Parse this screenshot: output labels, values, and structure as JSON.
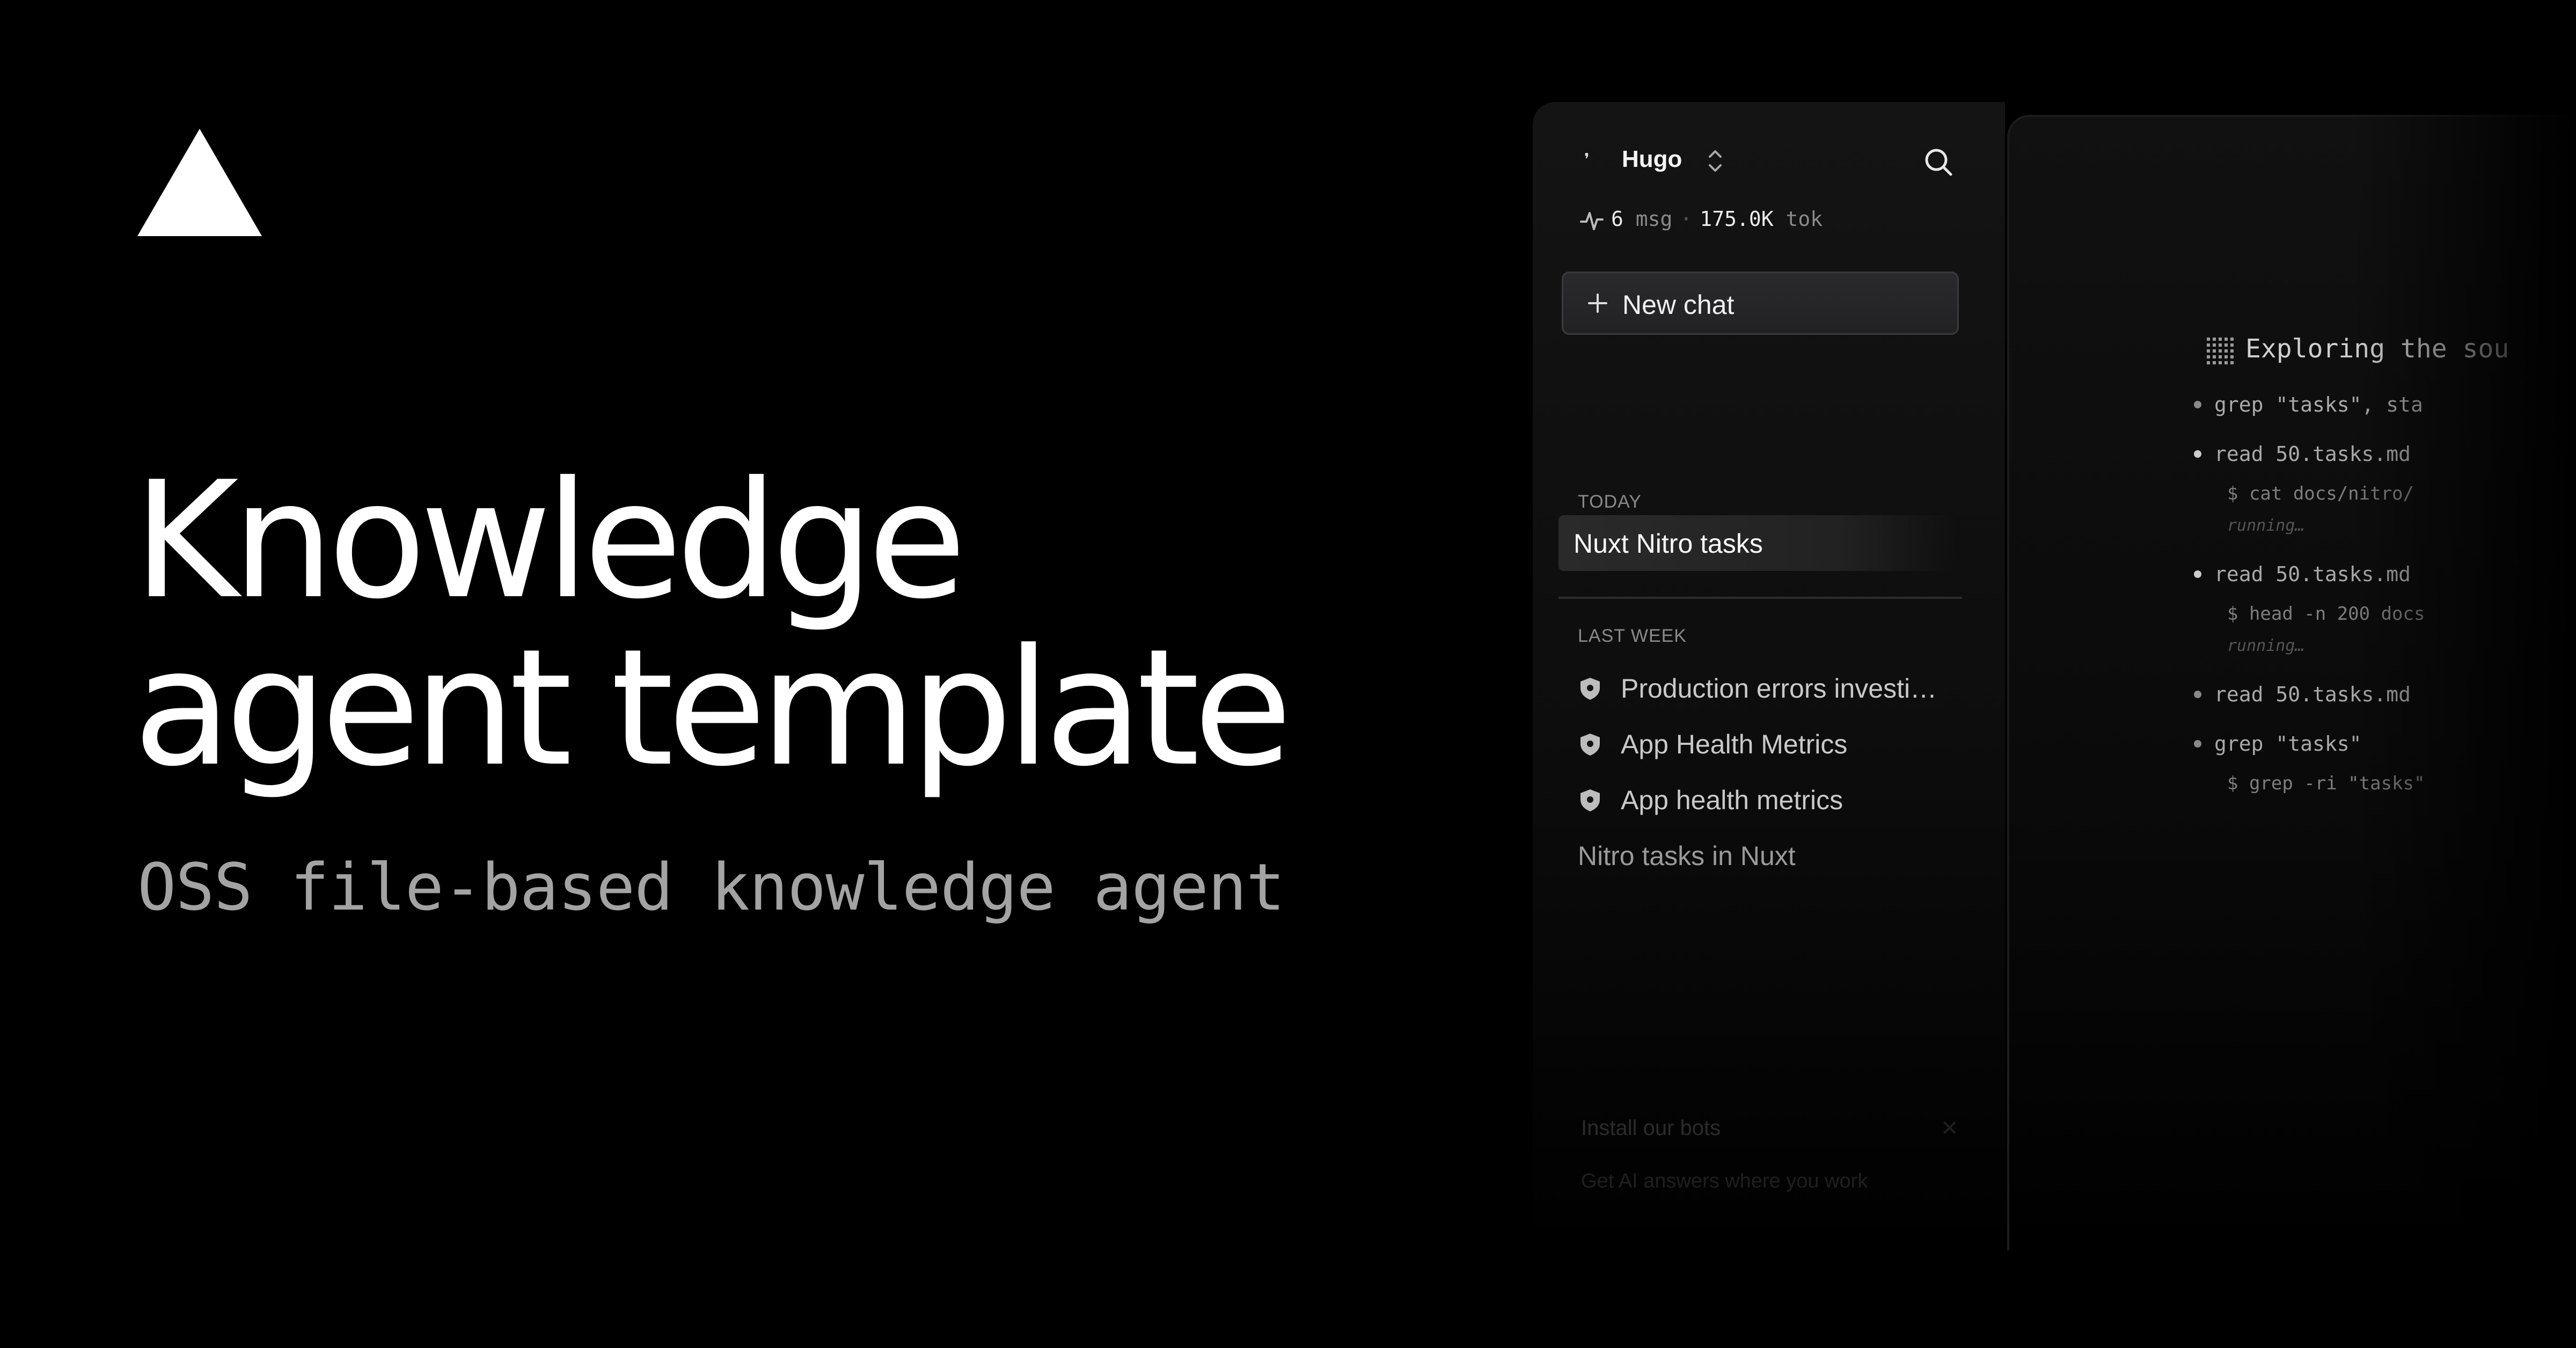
{
  "hero": {
    "title_line1": "Knowledge",
    "title_line2": "agent template",
    "subtitle": "OSS file-based knowledge agent"
  },
  "sidebar": {
    "user": "Hugo",
    "stats": {
      "msg_count": "6",
      "msg_unit": "msg",
      "separator": "·",
      "tokens": "175.0K",
      "tok_unit": "tok"
    },
    "new_chat_label": "New chat",
    "sections": [
      {
        "label": "TODAY",
        "items": [
          {
            "label": "Nuxt Nitro tasks",
            "active": true
          }
        ]
      },
      {
        "label": "LAST WEEK",
        "items": [
          {
            "label": "Production errors investi…",
            "icon": "shield-icon"
          },
          {
            "label": "App Health Metrics",
            "icon": "shield-icon"
          },
          {
            "label": "App health metrics",
            "icon": "shield-icon"
          },
          {
            "label": "Nitro tasks in Nuxt",
            "icon": ""
          }
        ]
      }
    ],
    "install": {
      "title": "Install our bots",
      "close": "✕",
      "subtitle": "Get AI answers where you work"
    }
  },
  "main": {
    "title": "Exploring the sou",
    "steps": [
      {
        "text": "grep \"tasks\", sta"
      },
      {
        "text": "read 50.tasks.md",
        "cmd": "$ cat docs/nitro/",
        "status": "running…"
      },
      {
        "text": "read 50.tasks.md",
        "cmd": "$ head -n 200 docs",
        "status": "running…"
      },
      {
        "text": "read 50.tasks.md"
      },
      {
        "text": "grep \"tasks\"",
        "cmd": "$ grep -ri \"tasks\""
      }
    ]
  },
  "colors": {
    "background": "#000000",
    "sidebar": "#141414",
    "active_item": "#2a2a2a",
    "new_chat_bg": "#262628",
    "muted_text": "#8a8a8a"
  }
}
